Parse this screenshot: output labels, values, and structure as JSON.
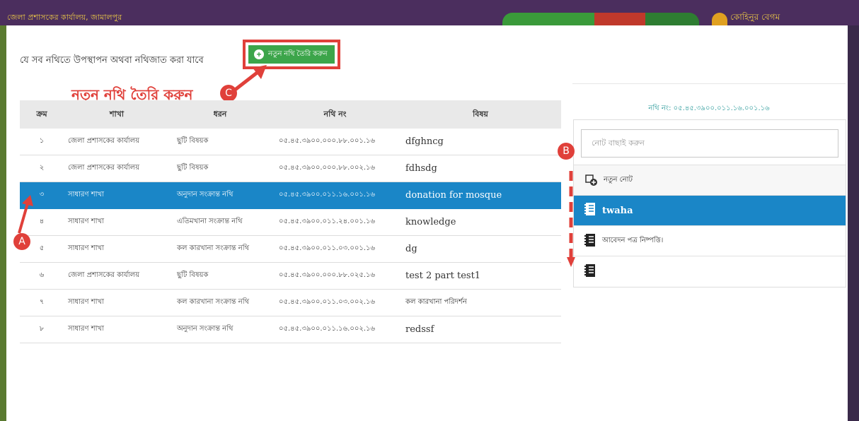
{
  "topbar": {
    "org_name": "জেলা প্রশাসকের কার্যালয়, জামালপুর",
    "user_name": "কোহিনুর বেগম",
    "pill_colors": [
      "#3a9a3a",
      "#3a9a3a",
      "#c0392b",
      "#2e7d32"
    ]
  },
  "header": {
    "title": "যে সব নথিতে উপস্থাপন অথবা নথিজাত করা যাবে",
    "new_file_button": "নতুন নথি তৈরি করুন"
  },
  "annotations": {
    "c_text": "নতুন নথি তৈরি করুন",
    "c_badge": "C",
    "a_badge": "A",
    "b_badge": "B",
    "color": "#e0403a"
  },
  "table": {
    "headers": [
      "ক্রম",
      "শাখা",
      "ধরন",
      "নথি নং",
      "বিষয়"
    ],
    "rows": [
      [
        "১",
        "জেলা প্রশাসকের কার্যালয়",
        "ছুটি বিষয়ক",
        "০৫.৪৫.৩৯০০.০০০.৮৮.০০১.১৬",
        "dfghncg"
      ],
      [
        "২",
        "জেলা প্রশাসকের কার্যালয়",
        "ছুটি বিষয়ক",
        "০৫.৪৫.৩৯০০.০০০.৮৮.০০২.১৬",
        "fdhsdg"
      ],
      [
        "৩",
        "সাধারণ শাখা",
        "অনুদান সংক্রান্ত নথি",
        "০৫.৪৫.৩৯০০.০১১.১৬.০০১.১৬",
        "donation for mosque"
      ],
      [
        "৪",
        "সাধারণ শাখা",
        "এতিমখানা সংক্রান্ত নথি",
        "০৫.৪৫.৩৯০০.০১১.২৪.০০১.১৬",
        "knowledge"
      ],
      [
        "৫",
        "সাধারণ শাখা",
        "কল কারখানা সংক্রান্ত নথি",
        "০৫.৪৫.৩৯০০.০১১.০৩.০০১.১৬",
        "dg"
      ],
      [
        "৬",
        "জেলা প্রশাসকের কার্যালয়",
        "ছুটি বিষয়ক",
        "০৫.৪৫.৩৯০০.০০০.৮৮.০২৫.১৬",
        "test 2 part test1"
      ],
      [
        "৭",
        "সাধারণ শাখা",
        "কল কারখানা সংক্রান্ত নথি",
        "০৫.৪৫.৩৯০০.০১১.০৩.০০২.১৬",
        "কল কারখানা পরিদর্শন"
      ],
      [
        "৮",
        "সাধারণ শাখা",
        "অনুদান সংক্রান্ত নথি",
        "০৫.৪৫.৩৯০০.০১১.১৬.০০২.১৬",
        "redssf"
      ]
    ],
    "selected_row": 2
  },
  "notes_panel": {
    "file_no": "নথি নং: ০৫.৪৫.৩৯০০.০১১.১৬.০০১.১৬",
    "search_placeholder": "নোট বাছাই করুন",
    "new_note_label": "নতুন নোট",
    "items": [
      "twaha",
      "আবেদন পত্র নিষ্পত্তি।",
      ""
    ],
    "selected_item": 0
  },
  "colors": {
    "accent_blue": "#1a86c7",
    "green": "#3ca54a",
    "red": "#e0403a",
    "header_purple": "#4b2e5e"
  }
}
